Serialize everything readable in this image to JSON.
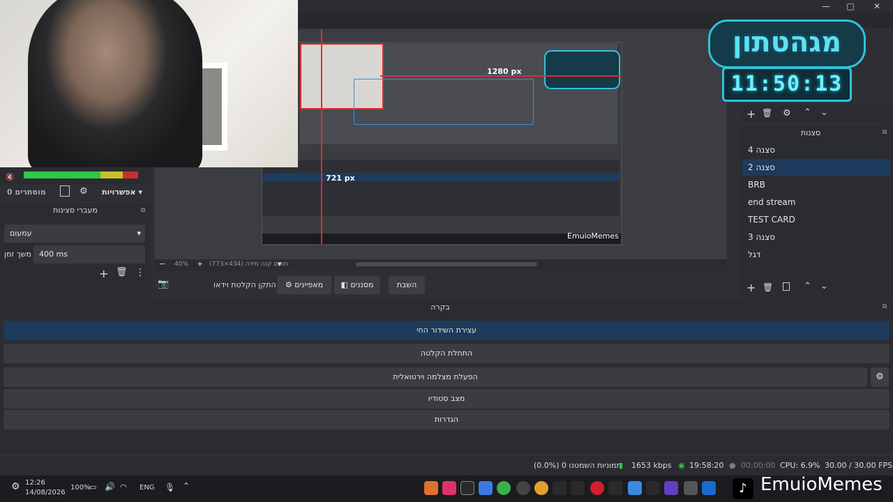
{
  "window": {
    "minimize": "—",
    "maximize": "□",
    "close": "✕"
  },
  "preview": {
    "label_width": "1280 px",
    "label_height": "721 px",
    "nested_brand": "EmuioMemes",
    "mega_title": "מגהטתון",
    "mega_time": "11:50:13"
  },
  "preview_bar": {
    "zoom_out": "−",
    "zoom": "40%",
    "zoom_in": "+",
    "size_text": "תואם קנה מידה (434×773)",
    "dropdown": "▾"
  },
  "audio": {
    "label": "מוסתרים 0",
    "settings": "אפשרויות"
  },
  "transitions": {
    "title": "מעברי סצינות",
    "selected": "עמעום",
    "duration_label": "משך זמן",
    "duration_value": "400 ms"
  },
  "scenes": {
    "title": "סצנות",
    "items": [
      "סצנה 4",
      "סצנה 2",
      "BRB",
      "end stream",
      "TEST CARD",
      "סצנה 3",
      "דגל"
    ],
    "selected_index": 1
  },
  "toolbar": {
    "pause": "השבת",
    "filters": "מסננים",
    "properties": "מאפיינים",
    "fix_video": "התקן הקלטת וידאו"
  },
  "controls": {
    "title": "בקרה",
    "buttons": [
      "עצירת השידור החי",
      "התחלת הקלטה",
      "הפעלת מצלמה וירטואלית",
      "מצב סטודיו",
      "הגדרות"
    ]
  },
  "status": {
    "frames_dropped": "(0.0%) 0 תמוניות השמטנו",
    "kbps": "1653 kbps",
    "stream_time": "19:58:20",
    "rec_time": "00:00:00",
    "cpu": "CPU: 6.9%",
    "fps": "30.00 / 30.00 FPS"
  },
  "taskbar": {
    "time": "12:26",
    "date": "14/08/2026",
    "battery": "100%",
    "lang": "ENG",
    "brand": "EmuioMemes"
  },
  "colors": {
    "accent": "#1e3a5c",
    "red": "#d83030",
    "blue": "#3a8fe0",
    "cyan": "#2fc4dc"
  }
}
